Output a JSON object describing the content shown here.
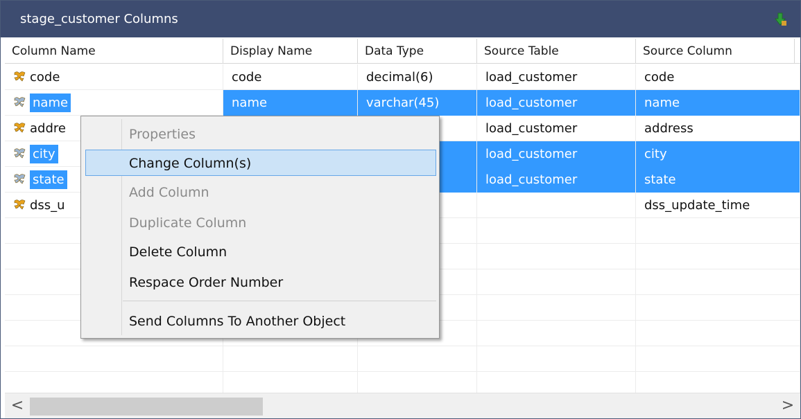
{
  "panel": {
    "title": "stage_customer Columns",
    "pin_icon": "pin-arrow-icon"
  },
  "columns": {
    "headers": [
      "Column Name",
      "Display Name",
      "Data Type",
      "Source Table",
      "Source Column"
    ]
  },
  "rows": [
    {
      "name": "code",
      "display": "code",
      "type": "decimal(6)",
      "source_table": "load_customer",
      "source_column": "code",
      "selected": false
    },
    {
      "name": "name",
      "display": "name",
      "type": "varchar(45)",
      "source_table": "load_customer",
      "source_column": "name",
      "selected": true
    },
    {
      "name": "addre",
      "display": "",
      "type": ")",
      "source_table": "load_customer",
      "source_column": "address",
      "selected": false
    },
    {
      "name": "city",
      "display": "",
      "type": ")",
      "source_table": "load_customer",
      "source_column": "city",
      "selected": true
    },
    {
      "name": "state",
      "display": "",
      "type": "",
      "source_table": "load_customer",
      "source_column": "state",
      "selected": true
    },
    {
      "name": "dss_u",
      "display": "",
      "type": "",
      "source_table": "",
      "source_column": "dss_update_time",
      "selected": false
    }
  ],
  "context_menu": {
    "items": [
      {
        "label": "Properties",
        "disabled": true
      },
      {
        "label": "Change Column(s)",
        "disabled": false,
        "hover": true
      },
      {
        "label": "Add Column",
        "disabled": true
      },
      {
        "label": "Duplicate Column",
        "disabled": true
      },
      {
        "label": "Delete Column",
        "disabled": false
      },
      {
        "label": "Respace Order Number",
        "disabled": false
      },
      {
        "label": "Send Columns To Another Object",
        "disabled": false
      }
    ]
  },
  "scrollbar": {
    "left_arrow": "<",
    "right_arrow": ">"
  },
  "colors": {
    "titlebar": "#3d4c70",
    "selection": "#3399ff",
    "menu_hover": "#cce3f7"
  }
}
